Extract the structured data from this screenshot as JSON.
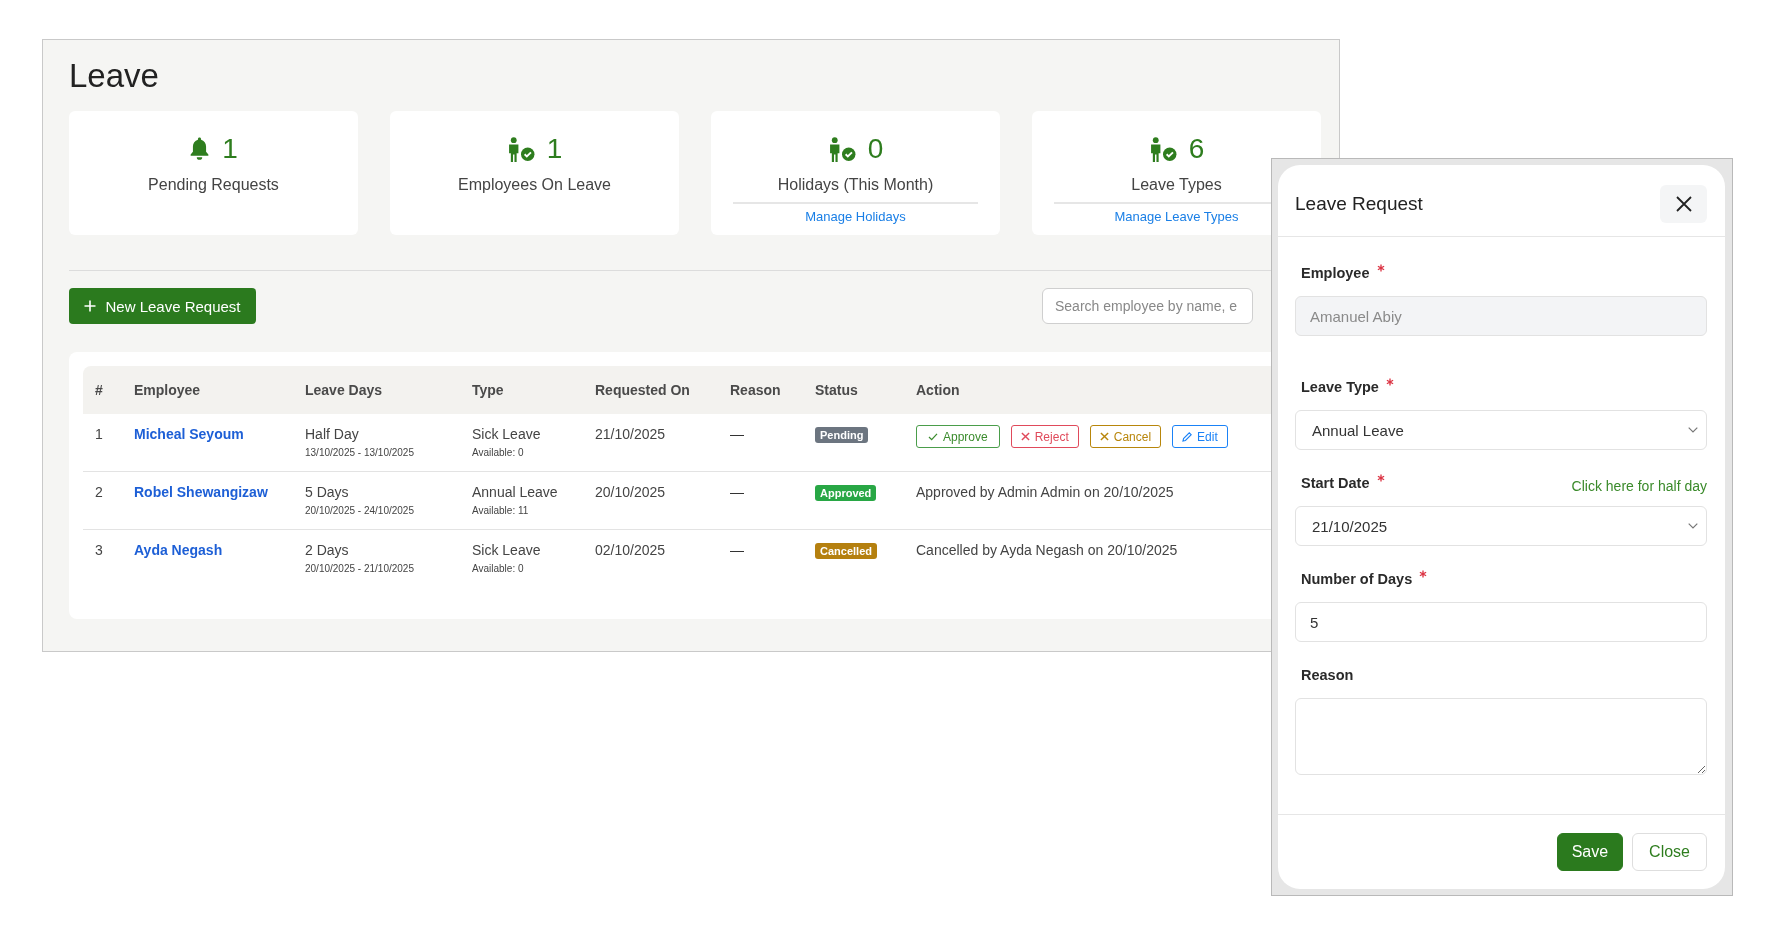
{
  "page": {
    "title": "Leave"
  },
  "stats": [
    {
      "kind": "pending",
      "value": "1",
      "label": "Pending Requests"
    },
    {
      "kind": "count",
      "value": "1",
      "label": "Employees On Leave"
    },
    {
      "kind": "count",
      "value": "0",
      "label": "Holidays (This Month)",
      "link": "Manage Holidays"
    },
    {
      "kind": "count",
      "value": "6",
      "label": "Leave Types",
      "link": "Manage Leave Types"
    }
  ],
  "toolbar": {
    "new_button": "New Leave Request",
    "search": {
      "placeholder": "Search employee by name, e"
    }
  },
  "table": {
    "columns": [
      "#",
      "Employee",
      "Leave Days",
      "Type",
      "Requested On",
      "Reason",
      "Status",
      "Action"
    ],
    "rows": [
      {
        "number": "1",
        "employee": "Micheal Seyoum",
        "leave_days": "Half Day",
        "date_range": "13/10/2025 - 13/10/2025",
        "type": "Sick Leave",
        "available": "Available: 0",
        "requested_on": "21/10/2025",
        "reason": "—",
        "status": {
          "label": "Pending",
          "color": "#6c7580"
        },
        "actions": [
          {
            "kind": "approve",
            "label": "Approve"
          },
          {
            "kind": "reject",
            "label": "Reject"
          },
          {
            "kind": "cancel",
            "label": "Cancel"
          },
          {
            "kind": "edit",
            "label": "Edit"
          }
        ]
      },
      {
        "number": "2",
        "employee": "Robel Shewangizaw",
        "leave_days": "5 Days",
        "date_range": "20/10/2025 - 24/10/2025",
        "type": "Annual Leave",
        "available": "Available: 11",
        "requested_on": "20/10/2025",
        "reason": "—",
        "status": {
          "label": "Approved",
          "color": "#28a745"
        },
        "action_note": "Approved by Admin Admin on 20/10/2025"
      },
      {
        "number": "3",
        "employee": "Ayda Negash",
        "leave_days": "2 Days",
        "date_range": "20/10/2025 - 21/10/2025",
        "type": "Sick Leave",
        "available": "Available: 0",
        "requested_on": "02/10/2025",
        "reason": "—",
        "status": {
          "label": "Cancelled",
          "color": "#b5800f"
        },
        "action_note": "Cancelled by Ayda Negash on 20/10/2025"
      }
    ]
  },
  "modal": {
    "title": "Leave Request",
    "fields": [
      {
        "kind": "text",
        "label": "Employee",
        "required": true,
        "disabled": true,
        "value": "Amanuel Abiy"
      },
      {
        "kind": "select",
        "label": "Leave Type",
        "required": true,
        "disabled": false,
        "value": "Annual Leave"
      },
      {
        "kind": "select",
        "label": "Start Date",
        "required": true,
        "disabled": false,
        "value": "21/10/2025",
        "link": "Click here for half day"
      },
      {
        "kind": "text",
        "label": "Number of Days",
        "required": true,
        "disabled": false,
        "value": "5"
      },
      {
        "kind": "textarea",
        "label": "Reason",
        "required": false,
        "disabled": false
      }
    ],
    "buttons": [
      {
        "kind": "submit",
        "label": "Save"
      },
      {
        "kind": "dismiss",
        "label": "Close"
      }
    ]
  }
}
